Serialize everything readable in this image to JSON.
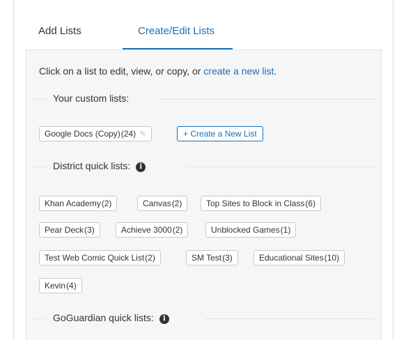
{
  "tabs": [
    {
      "label": "Add Lists",
      "active": false
    },
    {
      "label": "Create/Edit Lists",
      "active": true
    }
  ],
  "intro": {
    "text": "Click on a list to edit, view, or copy, or ",
    "link": "create a new list",
    "suffix": "."
  },
  "custom": {
    "heading": "Your custom lists:",
    "lists": [
      {
        "name": "Google Docs (Copy)",
        "count": "(24)"
      }
    ],
    "create_label": "+ Create a New List"
  },
  "district": {
    "heading": "District quick lists:",
    "lists": [
      {
        "name": "Khan Academy",
        "count": "(2)"
      },
      {
        "name": "Canvas",
        "count": "(2)"
      },
      {
        "name": "Top Sites to Block in Class",
        "count": "(6)"
      },
      {
        "name": "Pear Deck",
        "count": "(3)"
      },
      {
        "name": "Achieve 3000",
        "count": "(2)"
      },
      {
        "name": "Unblocked Games",
        "count": "(1)"
      },
      {
        "name": "Test Web Comic Quick List",
        "count": "(2)"
      },
      {
        "name": "SM Test",
        "count": "(3)"
      },
      {
        "name": "Educational Sites",
        "count": "(10)"
      },
      {
        "name": "Kevin",
        "count": "(4)"
      }
    ]
  },
  "goguardian": {
    "heading": "GoGuardian quick lists:"
  },
  "colors": {
    "accent": "#1a6eb5",
    "panel_bg": "#f5f6f7",
    "border": "#c8c8c8"
  },
  "icons": {
    "edit": "pencil-icon",
    "info": "info-icon"
  }
}
